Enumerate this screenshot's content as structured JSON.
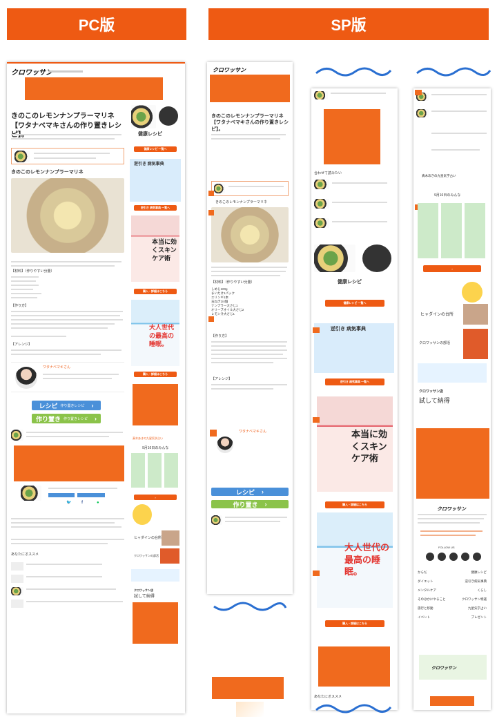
{
  "headers": {
    "pc": "PC版",
    "sp": "SP版"
  },
  "article": {
    "title_pc": "きのこのレモンナンプラーマリネ【ワタナベマキさんの作り置きレシピ】。",
    "title_sp": "きのこのレモンナンプラーマリネ【ワタナベマキさんの作り置きレシピ】。",
    "subheading": "きのこのレモンナンプラーマリネ",
    "ingredients_heading": "【材料】（作りやすい分量）",
    "method_heading": "【作り方】",
    "arrange_heading": "【アレンジ】",
    "author_name": "ワタナベマキさん",
    "sp_lines": [
      "しめじ100g",
      "まいたけ1パック",
      "エリンギ1本",
      "玉ねぎ1/4個",
      "ナンプラー大さじ1",
      "オリーブオイル大さじ2",
      "レモン汁大さじ1"
    ]
  },
  "sidebar": {
    "healthy_recipe": "健康レシピ",
    "byoki_jiten": "逆引き 病気事典",
    "book1": "本当に効くスキンケア術",
    "book2": "大人世代の最高の睡眠。",
    "weather": "真木あきの九星気学占い",
    "weather_date": "9月16日のみんな",
    "hygiene": "ヒャダインの台所",
    "croissant_club": "クロワッサンの部活",
    "croissant_store": "クロワッサン店",
    "store_sub": "試して納得",
    "follow": "FOLLOW US"
  },
  "buttons": {
    "recipe": "レシピ",
    "recipe_sub": "作り置きレシピ",
    "tsukurioki": "作り置き",
    "tsukurioki_sub": "作り置きレシピ",
    "more": "健康レシピ 一覧へ",
    "more2": "逆引き 病気事典 一覧へ",
    "buy": "購入・詳細はこちら"
  },
  "footer_links": [
    [
      "からだ",
      "健康レシピ"
    ],
    [
      "ダイエット",
      "逆引き病気事典"
    ],
    [
      "メンタルケア",
      "くらし"
    ],
    [
      "そのほかにやること",
      "クロワッサン特選"
    ],
    [
      "旅行と移動",
      "九星気学占い"
    ],
    [
      "イベント",
      "プレゼント"
    ]
  ],
  "related_heading": "合わせて読みたい",
  "recommend": "あなたにオススメ",
  "logo": "クロワッサン",
  "colors": {
    "accent": "#ee5a13",
    "wave": "#2a6fd1",
    "blue_button": "#4a90d9",
    "green_button": "#8bc34a"
  }
}
